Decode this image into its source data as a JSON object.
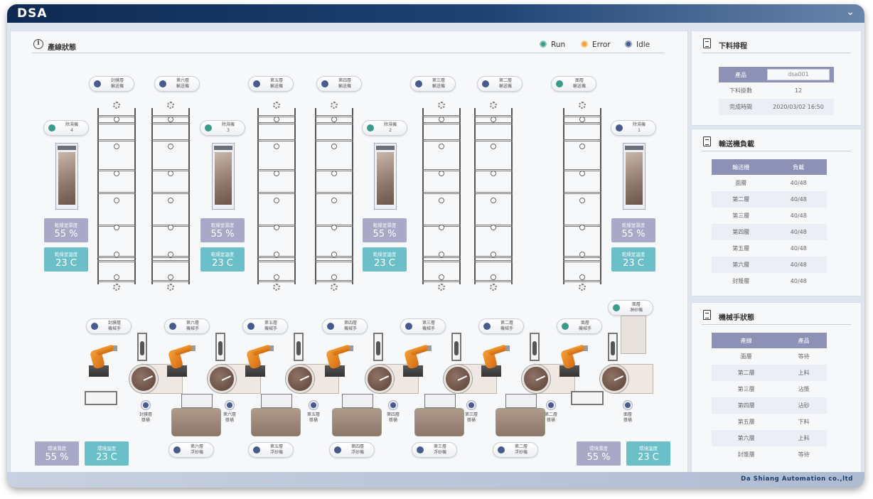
{
  "app": {
    "logo": "DSA",
    "company": "Da Shiang Automation co.,ltd"
  },
  "status_colors": {
    "run": "#3a9b88",
    "error": "#f0a038",
    "idle": "#465a8c"
  },
  "main": {
    "title": "產線狀態",
    "legend": {
      "run": "Run",
      "error": "Error",
      "idle": "Idle"
    },
    "top_conveyors": [
      {
        "label": "封膜層\n輸送機",
        "status": "idle"
      },
      {
        "label": "第六層\n輸送機",
        "status": "idle"
      },
      {
        "label": "第五層\n輸送機",
        "status": "idle"
      },
      {
        "label": "第四層\n輸送機",
        "status": "idle"
      },
      {
        "label": "第三層\n輸送機",
        "status": "idle"
      },
      {
        "label": "第二層\n輸送機",
        "status": "idle"
      },
      {
        "label": "面層\n輸送機",
        "status": "run"
      }
    ],
    "dehumidifiers": [
      {
        "label": "除濕機\n4",
        "status": "run"
      },
      {
        "label": "除濕機\n3",
        "status": "run"
      },
      {
        "label": "除濕機\n2",
        "status": "run"
      },
      {
        "label": "除濕機\n1",
        "status": "idle"
      }
    ],
    "dry_humidity_label": "乾燥室濕度",
    "dry_humidity_value": "55 %",
    "dry_temp_label": "乾燥室溫度",
    "dry_temp_value": "23 C",
    "robots": [
      {
        "label": "封膜層\n機械手",
        "status": "idle"
      },
      {
        "label": "第六層\n機械手",
        "status": "idle"
      },
      {
        "label": "第五層\n機械手",
        "status": "idle"
      },
      {
        "label": "第四層\n機械手",
        "status": "idle"
      },
      {
        "label": "第三層\n機械手",
        "status": "idle"
      },
      {
        "label": "第二層\n機械手",
        "status": "idle"
      },
      {
        "label": "面層\n機械手",
        "status": "run"
      }
    ],
    "shower": {
      "label": "面層\n淋砂機",
      "status": "run"
    },
    "mixers": [
      "封膜層\n漿桶",
      "第六層\n漿桶",
      "第五層\n漿桶",
      "第四層\n漿桶",
      "第三層\n漿桶",
      "第二層\n漿桶",
      "面層\n漿桶"
    ],
    "sand_machines": [
      "第六層\n浮砂機",
      "第五層\n浮砂機",
      "第四層\n浮砂機",
      "第三層\n浮砂機",
      "第二層\n浮砂機"
    ],
    "env_humidity_label": "環境濕度",
    "env_humidity_value": "55 %",
    "env_temp_label": "環境溫度",
    "env_temp_value": "23 C"
  },
  "schedule": {
    "title": "下料排程",
    "product_label": "產品",
    "product_value": "dsa001",
    "count_label": "下料掛數",
    "count_value": "12",
    "finish_label": "完成時間",
    "finish_value": "2020/03/02 16:50"
  },
  "load": {
    "title": "輸送機負載",
    "headers": [
      "輸送機",
      "負載"
    ],
    "rows": [
      [
        "面層",
        "40/48"
      ],
      [
        "第二層",
        "40/48"
      ],
      [
        "第三層",
        "40/48"
      ],
      [
        "第四層",
        "40/48"
      ],
      [
        "第五層",
        "40/48"
      ],
      [
        "第六層",
        "40/48"
      ],
      [
        "封漿層",
        "40/48"
      ]
    ]
  },
  "robot_status": {
    "title": "機械手狀態",
    "headers": [
      "產線",
      "產品"
    ],
    "rows": [
      [
        "面層",
        "等待"
      ],
      [
        "第二層",
        "上料"
      ],
      [
        "第三層",
        "沾漿"
      ],
      [
        "第四層",
        "沾砂"
      ],
      [
        "第五層",
        "下料"
      ],
      [
        "第六層",
        "上料"
      ],
      [
        "封漿層",
        "等待"
      ]
    ]
  }
}
